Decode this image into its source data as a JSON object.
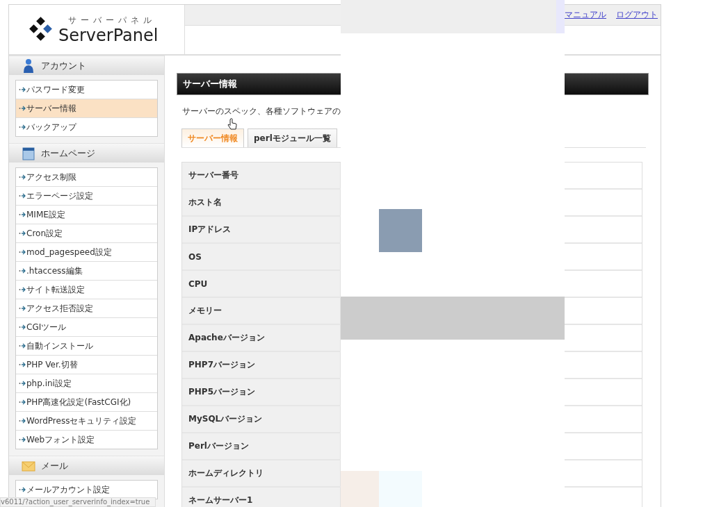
{
  "header": {
    "logo_kana": "サーバーパネル",
    "logo": "ServerPanel",
    "links": [
      "マニュアル",
      "ログアウト"
    ]
  },
  "sidebar": {
    "sections": [
      {
        "title": "アカウント",
        "kind": "account",
        "items": [
          {
            "label": "パスワード変更",
            "selected": false
          },
          {
            "label": "サーバー情報",
            "selected": true
          },
          {
            "label": "バックアップ",
            "selected": false
          }
        ]
      },
      {
        "title": "ホームページ",
        "kind": "homepage",
        "items": [
          {
            "label": "アクセス制限",
            "selected": false
          },
          {
            "label": "エラーページ設定",
            "selected": false
          },
          {
            "label": "MIME設定",
            "selected": false
          },
          {
            "label": "Cron設定",
            "selected": false
          },
          {
            "label": "mod_pagespeed設定",
            "selected": false
          },
          {
            "label": ".htaccess編集",
            "selected": false
          },
          {
            "label": "サイト転送設定",
            "selected": false
          },
          {
            "label": "アクセス拒否設定",
            "selected": false
          },
          {
            "label": "CGIツール",
            "selected": false
          },
          {
            "label": "自動インストール",
            "selected": false
          },
          {
            "label": "PHP Ver.切替",
            "selected": false
          },
          {
            "label": "php.ini設定",
            "selected": false
          },
          {
            "label": "PHP高速化設定(FastCGI化)",
            "selected": false
          },
          {
            "label": "WordPressセキュリティ設定",
            "selected": false
          },
          {
            "label": "Webフォント設定",
            "selected": false
          }
        ]
      },
      {
        "title": "メール",
        "kind": "mail",
        "items": [
          {
            "label": "メールアカウント設定",
            "selected": false
          }
        ]
      }
    ]
  },
  "main": {
    "title": "サーバー情報",
    "description": "サーバーのスペック、各種ソフトウェアの",
    "tabs": [
      {
        "label": "サーバー情報",
        "selected": true
      },
      {
        "label": "perlモジュール一覧",
        "selected": false
      }
    ],
    "table": {
      "rows": [
        {
          "label": "サーバー番号"
        },
        {
          "label": "ホスト名"
        },
        {
          "label": "IPアドレス"
        },
        {
          "label": "OS"
        },
        {
          "label": "CPU"
        },
        {
          "label": "メモリー"
        },
        {
          "label": "Apacheバージョン"
        },
        {
          "label": "PHP7バージョン"
        },
        {
          "label": "PHP5バージョン"
        },
        {
          "label": "MySQLバージョン"
        },
        {
          "label": "Perlバージョン"
        },
        {
          "label": "ホームディレクトリ"
        },
        {
          "label": "ネームサーバー1"
        }
      ]
    }
  },
  "status_bar": "v6011/?action_user_serverinfo_index=true"
}
